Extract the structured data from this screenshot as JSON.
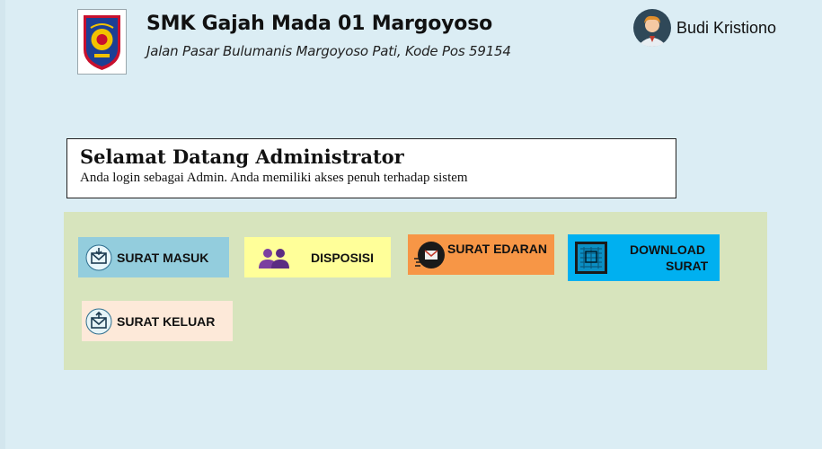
{
  "header": {
    "school_name": "SMK Gajah Mada 01 Margoyoso",
    "address": "Jalan Pasar Bulumanis Margoyoso Pati, Kode Pos 59154",
    "logo_icon": "school-crest-icon"
  },
  "user": {
    "name": "Budi Kristiono",
    "avatar_icon": "user-avatar-icon"
  },
  "welcome": {
    "title": "Selamat Datang Administrator",
    "subtitle": "Anda login sebagai Admin. Anda memiliki akses penuh terhadap sistem"
  },
  "menu": {
    "surat_masuk": {
      "label": "SURAT MASUK",
      "icon": "mail-inbox-icon",
      "color": "#93cddd"
    },
    "disposisi": {
      "label": "DISPOSISI",
      "icon": "people-icon",
      "color": "#ffff99"
    },
    "surat_edaran": {
      "label": "SURAT EDARAN",
      "icon": "send-mail-icon",
      "color": "#f79646"
    },
    "download_surat": {
      "label_line1": "DOWNLOAD",
      "label_line2": "SURAT",
      "icon": "download-document-icon",
      "color": "#00b0f0"
    },
    "surat_keluar": {
      "label": "SURAT KELUAR",
      "icon": "mail-outbox-icon",
      "color": "#fde9d9"
    }
  },
  "colors": {
    "background": "#dbedf4",
    "panel": "#d7e4bd"
  }
}
